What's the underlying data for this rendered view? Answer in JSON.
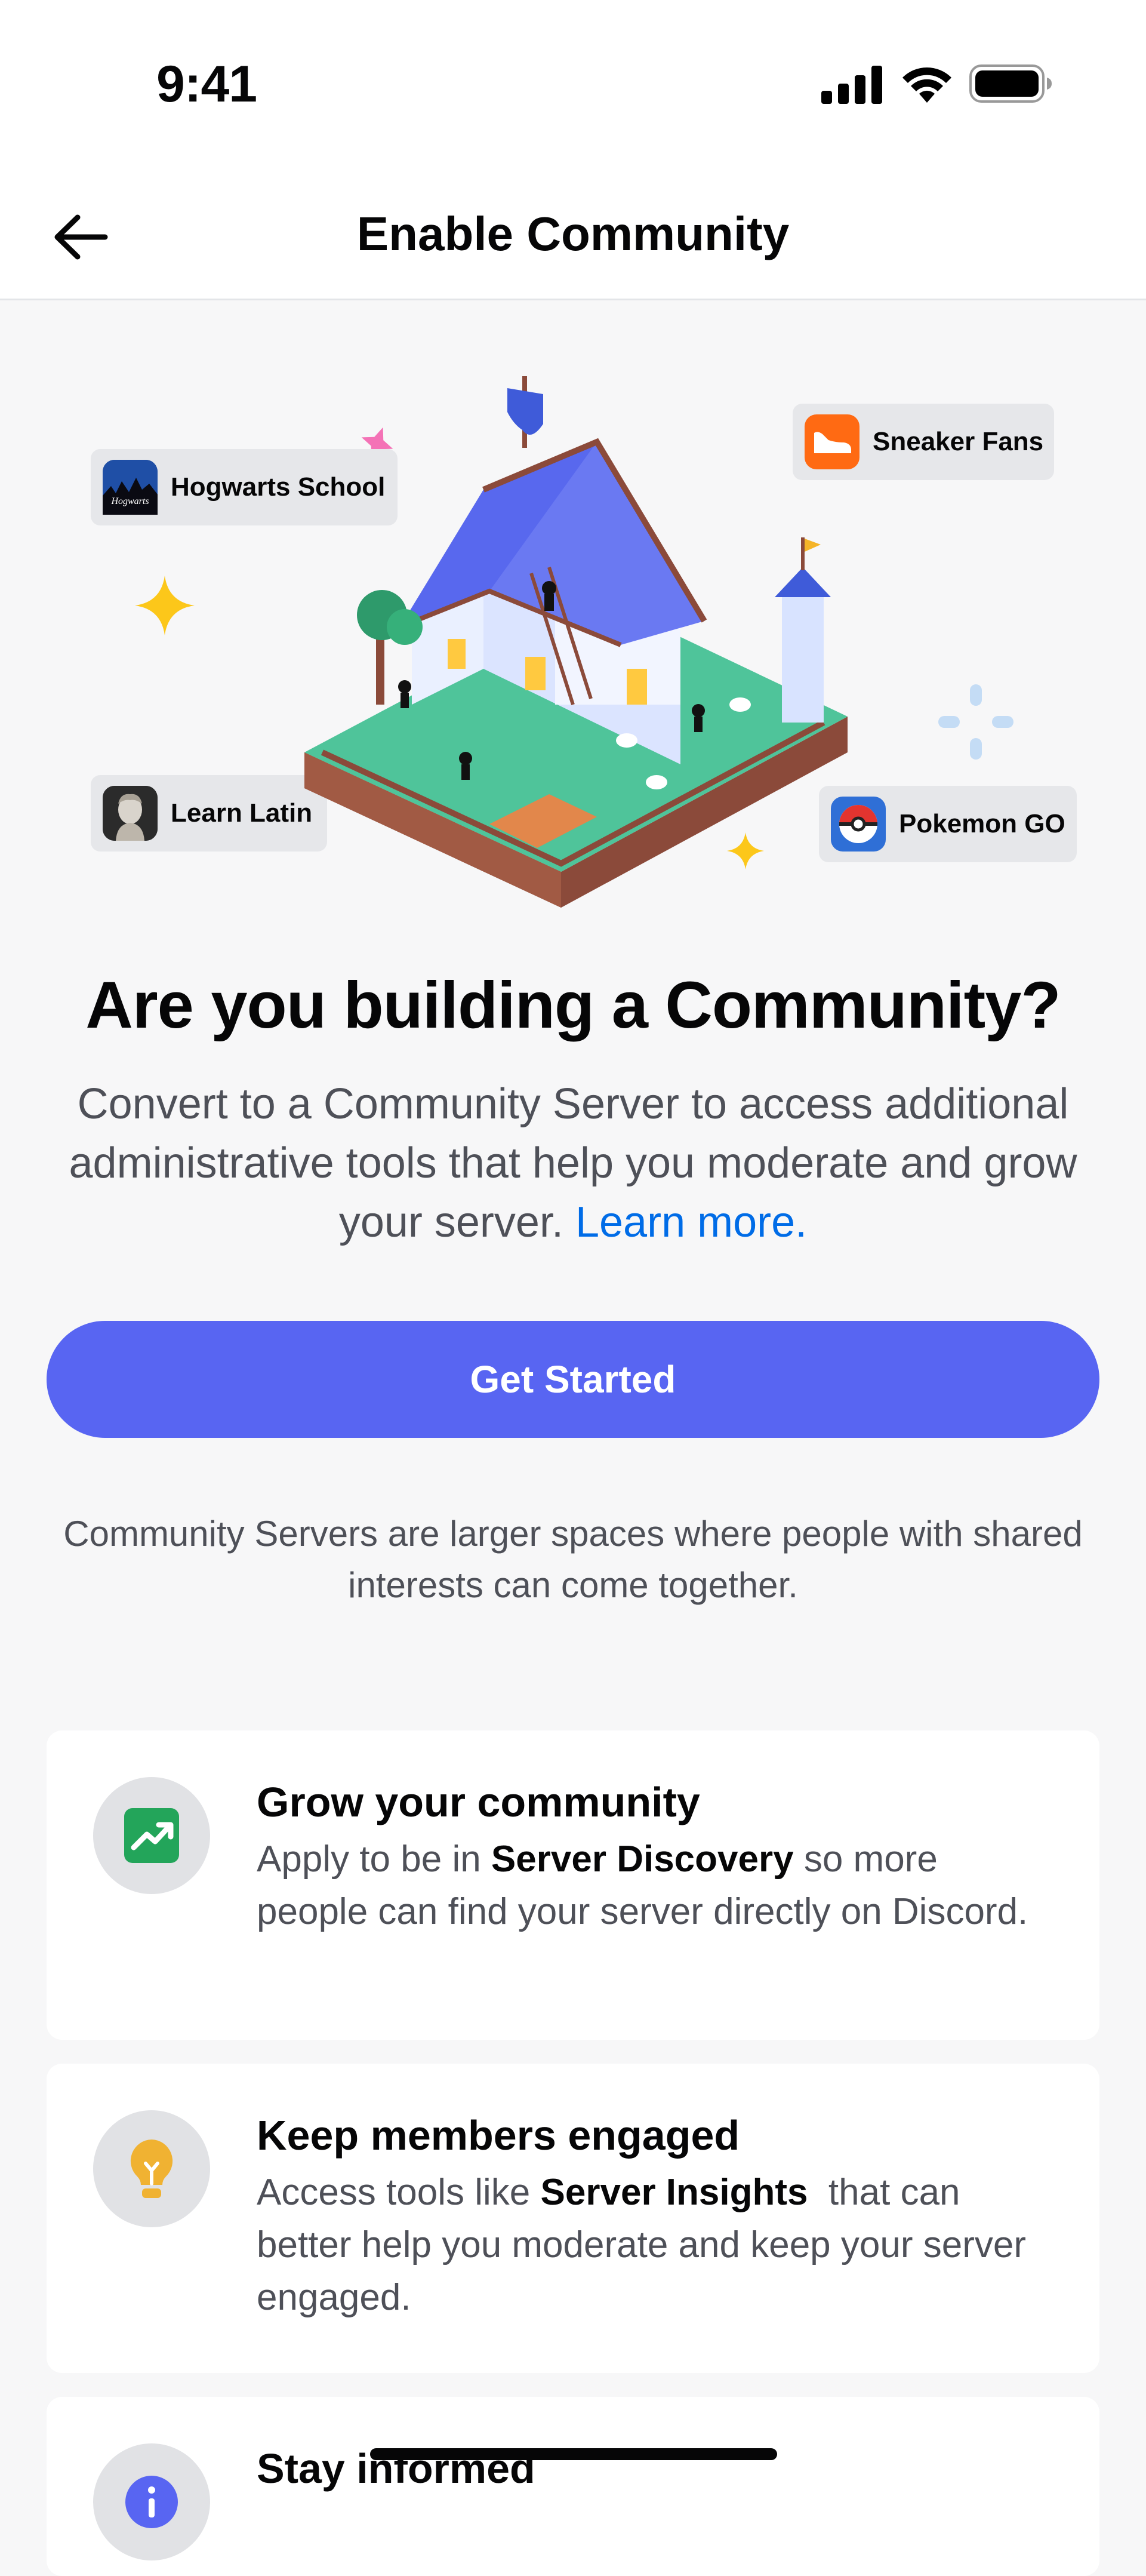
{
  "status_bar": {
    "time": "9:41",
    "icons": [
      "signal-icon",
      "wifi-icon",
      "battery-icon"
    ]
  },
  "header": {
    "back_icon": "arrow-left-icon",
    "title": "Enable Community"
  },
  "hero": {
    "servers": [
      {
        "name": "Hogwarts School",
        "icon": "hogwarts-icon"
      },
      {
        "name": "Sneaker Fans",
        "icon": "sneaker-icon"
      },
      {
        "name": "Learn Latin",
        "icon": "statue-icon"
      },
      {
        "name": "Pokemon GO",
        "icon": "pokeball-icon"
      }
    ],
    "illustration": "community-house-illustration",
    "hogwarts_icon_text": "Hogwarts"
  },
  "main": {
    "heading": "Are you building a Community?",
    "description": "Convert to a Community Server to access additional administrative tools that help you moderate and grow your server.",
    "learn_more": "Learn more.",
    "button": "Get Started",
    "info": "Community Servers are larger spaces where people with shared interests can come together."
  },
  "features": [
    {
      "title": "Grow your community",
      "pre": "Apply to be in ",
      "bold": "Server Discovery",
      "post": " so more people can find your server directly on Discord.",
      "icon": "trending-up-icon",
      "color": "#23a55a"
    },
    {
      "title": "Keep members engaged",
      "pre": "Access tools like ",
      "bold": "Server Insights",
      "post": "  that can better help you moderate and keep your server engaged.",
      "icon": "lightbulb-icon",
      "color": "#f0b232"
    },
    {
      "title": "Stay informed",
      "icon": "info-icon",
      "color": "#5865f2"
    }
  ],
  "colors": {
    "accent": "#5865f2",
    "link": "#006ce7"
  }
}
